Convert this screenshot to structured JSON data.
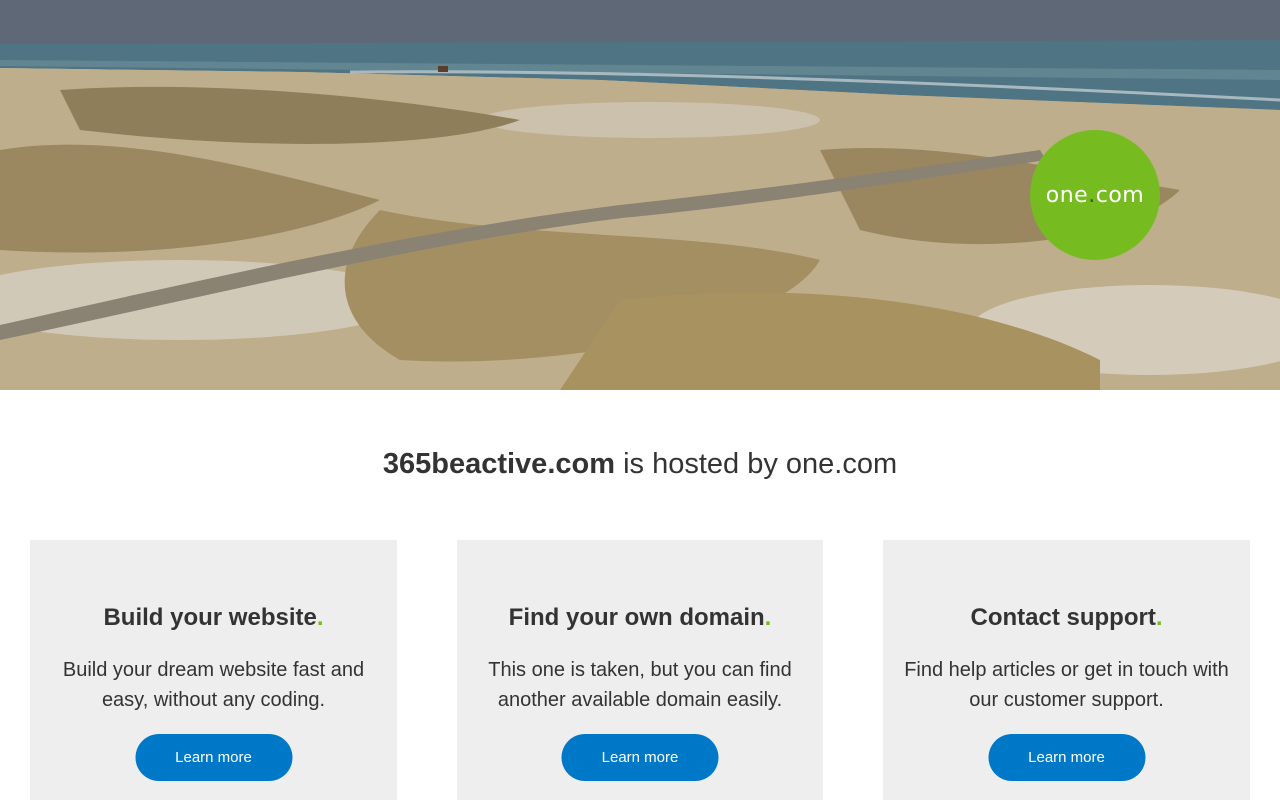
{
  "hero": {
    "logo": {
      "name": "one",
      "dot": ".",
      "tld": "com"
    }
  },
  "headline": {
    "domain": "365beactive.com",
    "rest": " is hosted by one.com"
  },
  "cards": [
    {
      "title": "Build your website",
      "accent": ".",
      "body": "Build your dream website fast and easy, without any coding.",
      "button": "Learn more"
    },
    {
      "title": "Find your own domain",
      "accent": ".",
      "body": "This one is taken, but you can find another available domain easily.",
      "button": "Learn more"
    },
    {
      "title": "Contact support",
      "accent": ".",
      "body": "Find help articles or get in touch with our customer support.",
      "button": "Learn more"
    }
  ],
  "colors": {
    "brand_green": "#76bc21",
    "button_blue": "#0078c8",
    "card_bg": "#eeeeee",
    "text": "#333333"
  }
}
